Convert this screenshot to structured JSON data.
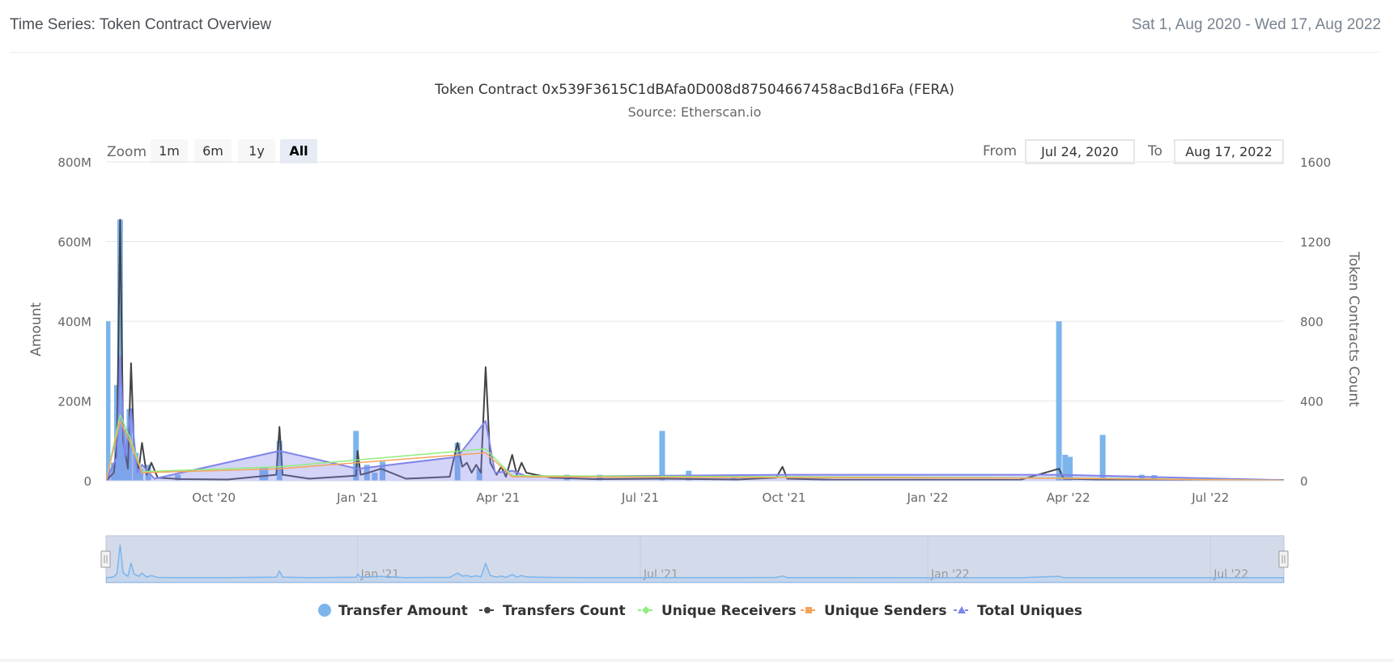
{
  "header": {
    "title": "Time Series: Token Contract Overview",
    "date_range": "Sat 1, Aug 2020 - Wed 17, Aug 2022"
  },
  "range_selector": {
    "zoom_label": "Zoom",
    "buttons": [
      "1m",
      "6m",
      "1y",
      "All"
    ],
    "selected": "All",
    "from_label": "From",
    "from_value": "Jul 24, 2020",
    "to_label": "To",
    "to_value": "Aug 17, 2022"
  },
  "colors": {
    "transfer_amount": "#7cb5ec",
    "transfers_count": "#434348",
    "unique_receivers": "#90ed7d",
    "unique_senders": "#f7a35c",
    "total_uniques": "#8085e9"
  },
  "chart_data": {
    "type": "bar",
    "title": "Token Contract 0x539F3615C1dBAfa0D008d87504667458acBd16Fa (FERA)",
    "subtitle": "Source: Etherscan.io",
    "x_range": [
      "2020-07-24",
      "2022-08-17"
    ],
    "x_ticks": [
      "Oct '20",
      "Jan '21",
      "Apr '21",
      "Jul '21",
      "Oct '21",
      "Jan '22",
      "Apr '22",
      "Jul '22"
    ],
    "left_axis": {
      "label": "Amount",
      "ticks": [
        "0",
        "200M",
        "400M",
        "600M",
        "800M"
      ],
      "range": [
        0,
        800000000
      ]
    },
    "right_axis": {
      "label": "Token Contracts Count",
      "ticks": [
        "0",
        "400",
        "800",
        "1200",
        "1600"
      ],
      "range": [
        0,
        1600
      ]
    },
    "navigator_ticks": [
      "Jan '21",
      "Jul '21",
      "Jan '22",
      "Jul '22"
    ],
    "legend": [
      "Transfer Amount",
      "Transfers Count",
      "Unique Receivers",
      "Unique Senders",
      "Total Uniques"
    ],
    "series": [
      {
        "name": "Transfer Amount",
        "type": "column",
        "axis": "left",
        "data": [
          [
            "2020-07-25",
            400000000
          ],
          [
            "2020-07-29",
            45000000
          ],
          [
            "2020-07-31",
            240000000
          ],
          [
            "2020-08-02",
            655000000
          ],
          [
            "2020-08-05",
            130000000
          ],
          [
            "2020-08-08",
            180000000
          ],
          [
            "2020-08-12",
            70000000
          ],
          [
            "2020-08-15",
            30000000
          ],
          [
            "2020-08-20",
            40000000
          ],
          [
            "2020-09-08",
            15000000
          ],
          [
            "2020-11-01",
            32000000
          ],
          [
            "2020-11-03",
            32000000
          ],
          [
            "2020-11-12",
            100000000
          ],
          [
            "2020-12-31",
            125000000
          ],
          [
            "2021-01-07",
            40000000
          ],
          [
            "2021-01-12",
            20000000
          ],
          [
            "2021-01-17",
            48000000
          ],
          [
            "2021-03-06",
            95000000
          ],
          [
            "2021-03-20",
            30000000
          ],
          [
            "2021-05-15",
            15000000
          ],
          [
            "2021-06-05",
            15000000
          ],
          [
            "2021-07-15",
            125000000
          ],
          [
            "2021-08-01",
            25000000
          ],
          [
            "2021-08-30",
            12000000
          ],
          [
            "2022-03-26",
            400000000
          ],
          [
            "2022-03-30",
            65000000
          ],
          [
            "2022-04-02",
            60000000
          ],
          [
            "2022-04-23",
            115000000
          ],
          [
            "2022-05-18",
            15000000
          ],
          [
            "2022-05-26",
            14000000
          ]
        ]
      },
      {
        "name": "Transfers Count",
        "type": "line",
        "axis": "right",
        "data": [
          [
            "2020-07-24",
            0
          ],
          [
            "2020-07-29",
            40
          ],
          [
            "2020-07-31",
            180
          ],
          [
            "2020-08-02",
            1310
          ],
          [
            "2020-08-04",
            200
          ],
          [
            "2020-08-07",
            60
          ],
          [
            "2020-08-09",
            590
          ],
          [
            "2020-08-11",
            150
          ],
          [
            "2020-08-14",
            60
          ],
          [
            "2020-08-16",
            190
          ],
          [
            "2020-08-19",
            30
          ],
          [
            "2020-08-22",
            90
          ],
          [
            "2020-08-26",
            15
          ],
          [
            "2020-09-10",
            8
          ],
          [
            "2020-10-10",
            6
          ],
          [
            "2020-11-10",
            30
          ],
          [
            "2020-11-12",
            270
          ],
          [
            "2020-11-14",
            30
          ],
          [
            "2020-12-01",
            10
          ],
          [
            "2020-12-31",
            25
          ],
          [
            "2021-01-01",
            150
          ],
          [
            "2021-01-03",
            30
          ],
          [
            "2021-01-08",
            40
          ],
          [
            "2021-01-16",
            60
          ],
          [
            "2021-02-01",
            10
          ],
          [
            "2021-03-01",
            20
          ],
          [
            "2021-03-06",
            190
          ],
          [
            "2021-03-09",
            70
          ],
          [
            "2021-03-12",
            90
          ],
          [
            "2021-03-15",
            40
          ],
          [
            "2021-03-18",
            80
          ],
          [
            "2021-03-21",
            40
          ],
          [
            "2021-03-24",
            570
          ],
          [
            "2021-03-27",
            90
          ],
          [
            "2021-03-31",
            30
          ],
          [
            "2021-04-03",
            70
          ],
          [
            "2021-04-06",
            20
          ],
          [
            "2021-04-10",
            130
          ],
          [
            "2021-04-13",
            30
          ],
          [
            "2021-04-16",
            90
          ],
          [
            "2021-04-19",
            40
          ],
          [
            "2021-04-25",
            30
          ],
          [
            "2021-05-05",
            15
          ],
          [
            "2021-06-01",
            8
          ],
          [
            "2021-07-15",
            10
          ],
          [
            "2021-09-01",
            6
          ],
          [
            "2021-09-26",
            15
          ],
          [
            "2021-09-30",
            70
          ],
          [
            "2021-10-03",
            10
          ],
          [
            "2021-11-01",
            5
          ],
          [
            "2022-03-01",
            4
          ],
          [
            "2022-03-26",
            60
          ],
          [
            "2022-03-29",
            10
          ],
          [
            "2022-05-01",
            4
          ],
          [
            "2022-08-17",
            4
          ]
        ]
      },
      {
        "name": "Total Uniques",
        "type": "line",
        "axis": "right",
        "data": [
          [
            "2020-07-24",
            0
          ],
          [
            "2020-07-31",
            120
          ],
          [
            "2020-08-02",
            620
          ],
          [
            "2020-08-05",
            120
          ],
          [
            "2020-08-09",
            360
          ],
          [
            "2020-08-13",
            40
          ],
          [
            "2020-08-16",
            80
          ],
          [
            "2020-08-24",
            10
          ],
          [
            "2020-11-12",
            150
          ],
          [
            "2021-01-01",
            60
          ],
          [
            "2021-03-06",
            120
          ],
          [
            "2021-03-24",
            300
          ],
          [
            "2021-03-30",
            40
          ],
          [
            "2021-04-10",
            50
          ],
          [
            "2021-04-20",
            20
          ],
          [
            "2021-09-30",
            30
          ],
          [
            "2022-03-26",
            30
          ],
          [
            "2022-08-17",
            3
          ]
        ]
      },
      {
        "name": "Unique Senders",
        "type": "line",
        "axis": "right",
        "data": [
          [
            "2020-07-24",
            0
          ],
          [
            "2020-08-02",
            300
          ],
          [
            "2020-08-09",
            180
          ],
          [
            "2020-08-16",
            40
          ],
          [
            "2020-11-12",
            60
          ],
          [
            "2021-03-24",
            140
          ],
          [
            "2021-04-10",
            20
          ],
          [
            "2022-03-26",
            12
          ],
          [
            "2022-08-17",
            2
          ]
        ]
      },
      {
        "name": "Unique Receivers",
        "type": "line",
        "axis": "right",
        "data": [
          [
            "2020-07-24",
            0
          ],
          [
            "2020-08-02",
            330
          ],
          [
            "2020-08-09",
            200
          ],
          [
            "2020-08-16",
            45
          ],
          [
            "2020-11-12",
            70
          ],
          [
            "2021-03-24",
            160
          ],
          [
            "2021-04-10",
            25
          ],
          [
            "2022-03-26",
            14
          ],
          [
            "2022-08-17",
            2
          ]
        ]
      }
    ]
  }
}
